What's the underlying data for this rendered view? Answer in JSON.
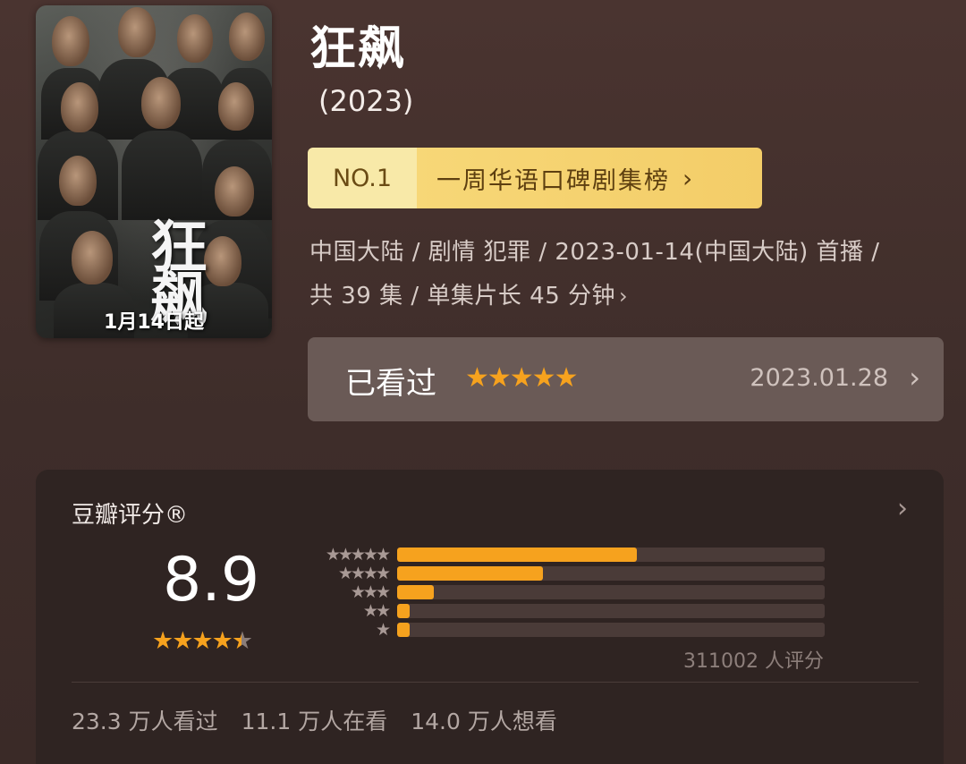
{
  "poster": {
    "title_text": "狂飙",
    "date_text": "1月14日起"
  },
  "title": "狂飙",
  "year": "(2023)",
  "ranking": {
    "badge": "NO.1",
    "name": "一周华语口碑剧集榜",
    "chevron_icon": "chevron-right-icon"
  },
  "meta": {
    "line1": "中国大陆 / 剧情 犯罪 / 2023-01-14(中国大陆) 首播 /",
    "line2": "共 39 集 / 单集片长 45 分钟"
  },
  "watched": {
    "label": "已看过",
    "my_rating_stars": 5,
    "stars_text": "★★★★★",
    "date": "2023.01.28"
  },
  "rating": {
    "title": "豆瓣评分®",
    "score": "8.9",
    "score_stars": 4.5,
    "distribution": [
      {
        "stars": 5,
        "stars_text": "★★★★★",
        "fraction": 0.56
      },
      {
        "stars": 4,
        "stars_text": "★★★★",
        "fraction": 0.34
      },
      {
        "stars": 3,
        "stars_text": "★★★",
        "fraction": 0.085
      },
      {
        "stars": 2,
        "stars_text": "★★",
        "fraction": 0.03
      },
      {
        "stars": 1,
        "stars_text": "★",
        "fraction": 0.03
      }
    ],
    "count_text": "311002 人评分",
    "stats": {
      "watched": "23.3 万人看过",
      "watching": "11.1 万人在看",
      "want": "14.0 万人想看"
    }
  },
  "colors": {
    "accent_star": "#f6a21e",
    "rank_badge_bg": "#f8e9a8",
    "rank_name_bg": "#f3cd68"
  }
}
